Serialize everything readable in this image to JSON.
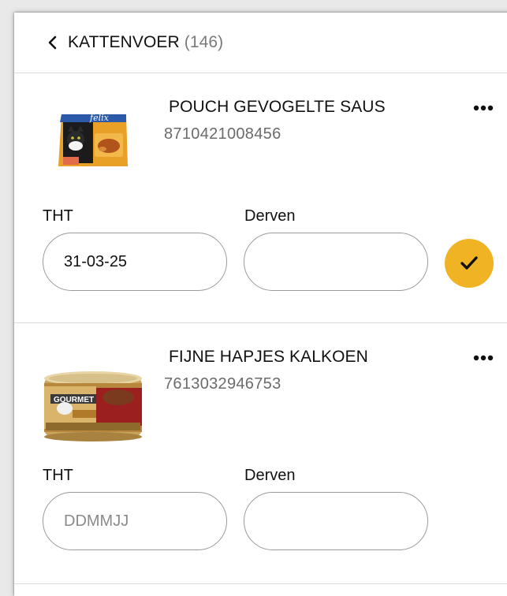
{
  "header": {
    "title": "KATTENVOER",
    "count": "(146)"
  },
  "products": [
    {
      "name": "POUCH GEVOGELTE SAUS",
      "code": "8710421008456",
      "brand": "felix",
      "tht_label": "THT",
      "tht_value": "31-03-25",
      "tht_placeholder": "",
      "derven_label": "Derven",
      "derven_value": "",
      "confirm_icon": "check-icon"
    },
    {
      "name": "FIJNE HAPJES KALKOEN",
      "code": "7613032946753",
      "brand": "GOURMET",
      "tht_label": "THT",
      "tht_value": "",
      "tht_placeholder": "DDMMJJ",
      "derven_label": "Derven",
      "derven_value": ""
    }
  ],
  "colors": {
    "accent": "#f0b323",
    "divider": "#d9d9d9",
    "field_border": "#9a9a9a"
  }
}
